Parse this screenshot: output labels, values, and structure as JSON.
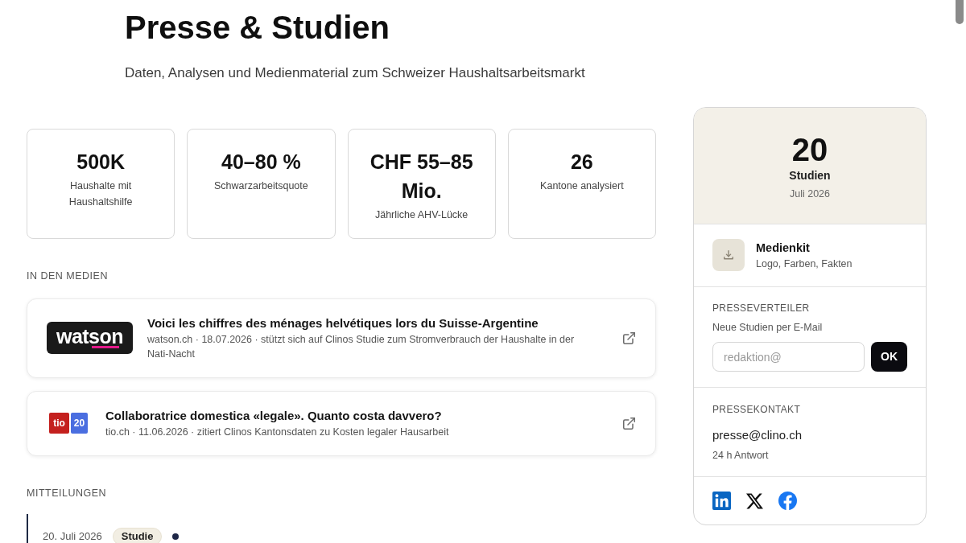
{
  "header": {
    "title": "Presse & Studien",
    "subtitle": "Daten, Analysen und Medienmaterial zum Schweizer Haushaltsarbeitsmarkt"
  },
  "stats": [
    {
      "value": "500K",
      "label": "Haushalte mit Haushaltshilfe"
    },
    {
      "value": "40–80 %",
      "label": "Schwarzarbeitsquote"
    },
    {
      "value": "CHF 55–85 Mio.",
      "label": "Jährliche AHV-Lücke"
    },
    {
      "value": "26",
      "label": "Kantone analysiert"
    }
  ],
  "in_den_medien": {
    "heading": "IN DEN MEDIEN",
    "items": [
      {
        "logo": {
          "kind": "wordmark",
          "text": [
            "watson"
          ]
        },
        "title": "Voici les chiffres des ménages helvétiques lors du Suisse-Argentine",
        "meta": "watson.ch · 18.07.2026 · stützt sich auf Clinos Studie zum Stromverbrauch der Haushalte in der Nati-Nacht"
      },
      {
        "logo": {
          "kind": "tiles",
          "text": [
            "tio",
            "20"
          ]
        },
        "title": "Collaboratrice domestica «legale». Quanto costa davvero?",
        "meta": "tio.ch · 11.06.2026 · zitiert Clinos Kantonsdaten zu Kosten legaler Hausarbeit"
      }
    ]
  },
  "mitteilungen": {
    "heading": "MITTEILUNGEN",
    "items": [
      {
        "date": "20. Juli 2026",
        "tag": "Studie",
        "new": true
      }
    ]
  },
  "sidebar": {
    "summary": {
      "count": "20",
      "label": "Studien",
      "date": "Juli 2026"
    },
    "media_kit": {
      "title": "Medienkit",
      "subtitle": "Logo, Farben, Fakten"
    },
    "presseverteiler": {
      "heading": "PRESSEVERTEILER",
      "text": "Neue Studien per E-Mail",
      "email_field": {
        "placeholder": "redaktion@"
      },
      "button": "OK"
    },
    "pressekontakt": {
      "heading": "PRESSEKONTAKT",
      "email": "presse@clino.ch",
      "note": "24 h Antwort"
    }
  }
}
